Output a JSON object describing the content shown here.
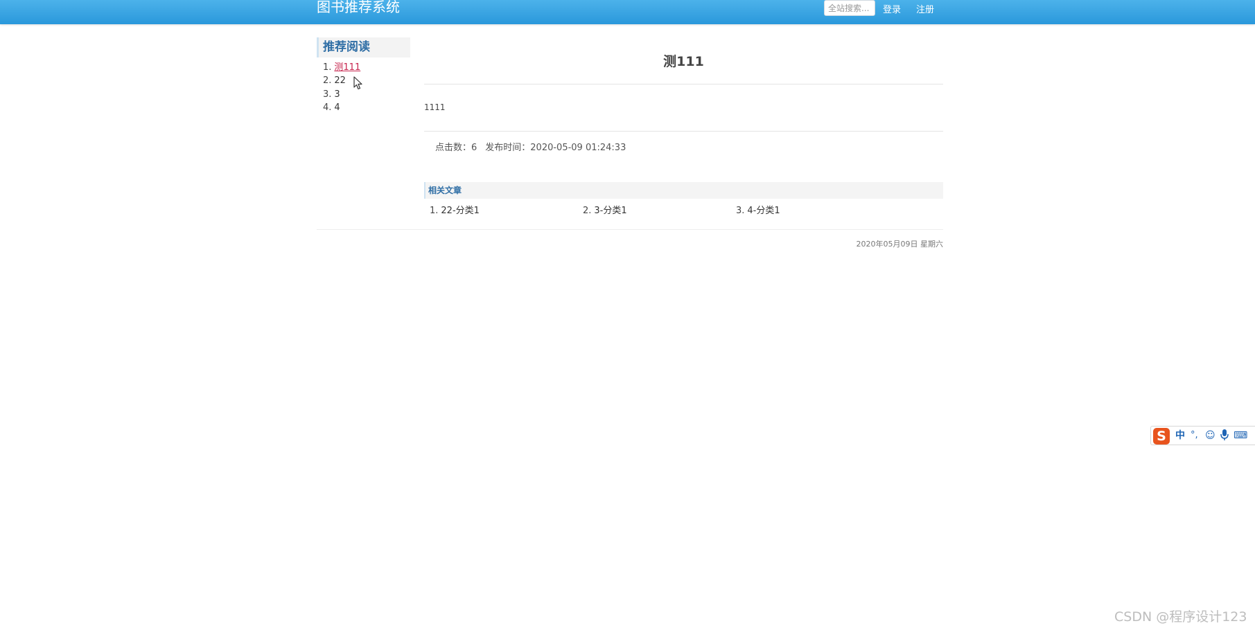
{
  "header": {
    "brand": "图书推荐系统",
    "search_placeholder": "全站搜索...",
    "login": "登录",
    "register": "注册"
  },
  "sidebar": {
    "title": "推荐阅读",
    "items": [
      {
        "num": "1.",
        "label": "测111"
      },
      {
        "num": "2.",
        "label": "22"
      },
      {
        "num": "3.",
        "label": "3"
      },
      {
        "num": "4.",
        "label": "4"
      }
    ]
  },
  "article": {
    "title": "测111",
    "body": "1111",
    "clicks": "点击数：6",
    "published": "发布时间：2020-05-09 01:24:33"
  },
  "related": {
    "title": "相关文章",
    "items": [
      {
        "num": "1.",
        "label": "22-分类1"
      },
      {
        "num": "2.",
        "label": "3-分类1"
      },
      {
        "num": "3.",
        "label": "4-分类1"
      }
    ]
  },
  "footer": {
    "date": "2020年05月09日 星期六"
  },
  "ime": {
    "logo": "S",
    "mode": "中",
    "punct": "°,",
    "emoji": "☺",
    "mic": "🎤",
    "keyboard": "⌨"
  },
  "watermark": "CSDN @程序设计123",
  "colors": {
    "header_bg": "#2a98db",
    "accent_blue": "#2f6ea5",
    "active_link": "#c7254e"
  }
}
